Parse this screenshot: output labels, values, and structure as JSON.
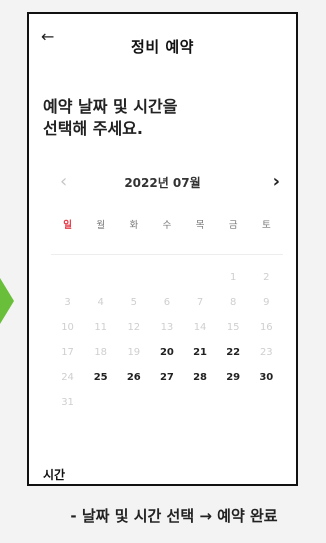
{
  "header": {
    "back_icon": "arrow-left-icon",
    "back_glyph": "←",
    "title": "정비 예약"
  },
  "prompt": {
    "line1": "예약 날짜 및 시간을",
    "line2": "선택해 주세요."
  },
  "calendar": {
    "month_label": "2022년 07월",
    "prev_glyph": "‹",
    "next_glyph": "›",
    "weekdays": [
      "일",
      "월",
      "화",
      "수",
      "목",
      "금",
      "토"
    ],
    "weeks": [
      [
        {
          "d": ""
        },
        {
          "d": ""
        },
        {
          "d": ""
        },
        {
          "d": ""
        },
        {
          "d": ""
        },
        {
          "d": "1",
          "s": "dis"
        },
        {
          "d": "2",
          "s": "dis"
        }
      ],
      [
        {
          "d": "3",
          "s": "dis"
        },
        {
          "d": "4",
          "s": "dis"
        },
        {
          "d": "5",
          "s": "dis"
        },
        {
          "d": "6",
          "s": "dis"
        },
        {
          "d": "7",
          "s": "dis"
        },
        {
          "d": "8",
          "s": "dis"
        },
        {
          "d": "9",
          "s": "dis"
        }
      ],
      [
        {
          "d": "10",
          "s": "dis"
        },
        {
          "d": "11",
          "s": "dis"
        },
        {
          "d": "12",
          "s": "dis"
        },
        {
          "d": "13",
          "s": "dis"
        },
        {
          "d": "14",
          "s": "dis"
        },
        {
          "d": "15",
          "s": "dis"
        },
        {
          "d": "16",
          "s": "dis"
        }
      ],
      [
        {
          "d": "17",
          "s": "dis"
        },
        {
          "d": "18",
          "s": "dis"
        },
        {
          "d": "19",
          "s": "dis"
        },
        {
          "d": "20",
          "s": "on"
        },
        {
          "d": "21",
          "s": "on"
        },
        {
          "d": "22",
          "s": "on"
        },
        {
          "d": "23",
          "s": "dis"
        }
      ],
      [
        {
          "d": "24",
          "s": "dis"
        },
        {
          "d": "25",
          "s": "on"
        },
        {
          "d": "26",
          "s": "on"
        },
        {
          "d": "27",
          "s": "on"
        },
        {
          "d": "28",
          "s": "on"
        },
        {
          "d": "29",
          "s": "on"
        },
        {
          "d": "30",
          "s": "on"
        }
      ],
      [
        {
          "d": "31",
          "s": "dis"
        },
        {
          "d": ""
        },
        {
          "d": ""
        },
        {
          "d": ""
        },
        {
          "d": ""
        },
        {
          "d": ""
        },
        {
          "d": ""
        }
      ]
    ]
  },
  "time": {
    "label": "시간"
  },
  "caption": "- 날짜 및 시간 선택 → 예약 완료",
  "colors": {
    "sunday": "#e63946",
    "accent_arrow": "#6abf3a",
    "disabled": "#cfcfcf"
  }
}
